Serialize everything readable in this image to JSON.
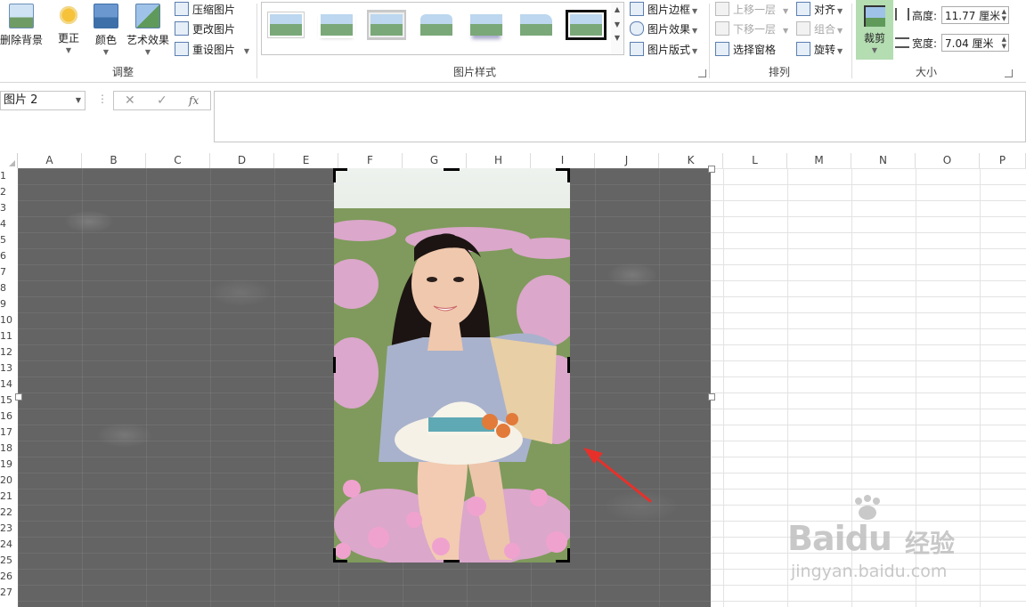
{
  "ribbon": {
    "adjust": {
      "group_label": "调整",
      "remove_bg": "删除背景",
      "corrections": "更正",
      "color": "颜色",
      "artistic": "艺术效果",
      "compress": "压缩图片",
      "change": "更改图片",
      "reset": "重设图片"
    },
    "picture_styles": {
      "group_label": "图片样式",
      "border": "图片边框",
      "effects": "图片效果",
      "layout": "图片版式"
    },
    "arrange": {
      "group_label": "排列",
      "bring_forward": "上移一层",
      "send_backward": "下移一层",
      "selection_pane": "选择窗格",
      "align": "对齐",
      "group": "组合",
      "rotate": "旋转"
    },
    "size": {
      "group_label": "大小",
      "crop": "裁剪",
      "height_label": "高度:",
      "height_value": "11.77 厘米",
      "width_label": "宽度:",
      "width_value": "7.04 厘米"
    }
  },
  "formula_bar": {
    "name_box": "图片 2",
    "fx": "fx"
  },
  "grid": {
    "columns": [
      "A",
      "B",
      "C",
      "D",
      "E",
      "F",
      "G",
      "H",
      "I",
      "J",
      "K",
      "L",
      "M",
      "N",
      "O",
      "P"
    ],
    "rows": [
      "1",
      "2",
      "3",
      "4",
      "5",
      "6",
      "7",
      "8",
      "9",
      "10",
      "11",
      "12",
      "13",
      "14",
      "15",
      "16",
      "17",
      "18",
      "19",
      "20",
      "21",
      "22",
      "23",
      "24",
      "25",
      "26",
      "27"
    ]
  },
  "watermark": {
    "brand": "Baidu",
    "brand_cn": "经验",
    "url": "jingyan.baidu.com"
  },
  "colors": {
    "crop_highlight": "#b4ddb2",
    "annotation_arrow": "#e8302a"
  }
}
